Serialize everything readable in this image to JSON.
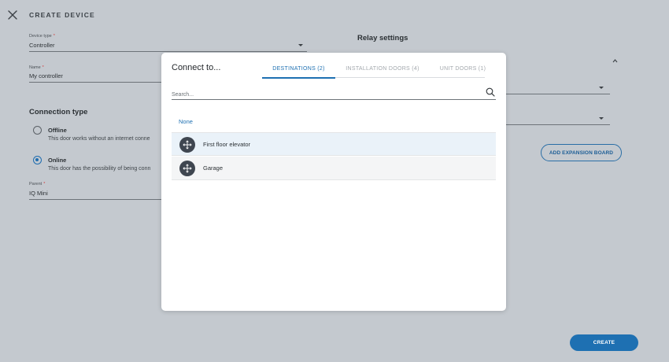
{
  "header": {
    "title": "CREATE DEVICE"
  },
  "form": {
    "device_type": {
      "label": "Device type",
      "required_mark": "*",
      "value": "Controller"
    },
    "name": {
      "label": "Name",
      "required_mark": "*",
      "value": "My controller"
    },
    "connection_type": {
      "title": "Connection type",
      "options": [
        {
          "title": "Offline",
          "description": "This door works without an internet conne",
          "checked": false
        },
        {
          "title": "Online",
          "description": "This door has the possibility of being conn",
          "checked": true
        }
      ]
    },
    "parent": {
      "label": "Parent",
      "required_mark": "*",
      "value": "IQ Mini"
    }
  },
  "relay": {
    "title": "Relay settings",
    "add_expansion_label": "ADD EXPANSION BOARD"
  },
  "footer": {
    "create_label": "CREATE"
  },
  "modal": {
    "title": "Connect to...",
    "tabs": [
      {
        "label": "DESTINATIONS (2)",
        "active": true
      },
      {
        "label": "INSTALLATION DOORS (4)",
        "active": false
      },
      {
        "label": "UNIT DOORS (1)",
        "active": false
      }
    ],
    "search": {
      "placeholder": "Search..."
    },
    "none_label": "None",
    "items": [
      {
        "label": "First floor elevator",
        "icon": "move-arrows-icon"
      },
      {
        "label": "Garage",
        "icon": "move-arrows-icon"
      }
    ]
  },
  "colors": {
    "accent": "#1e70b2",
    "overlay": "#c4c9cf",
    "required": "#d23b3b"
  }
}
